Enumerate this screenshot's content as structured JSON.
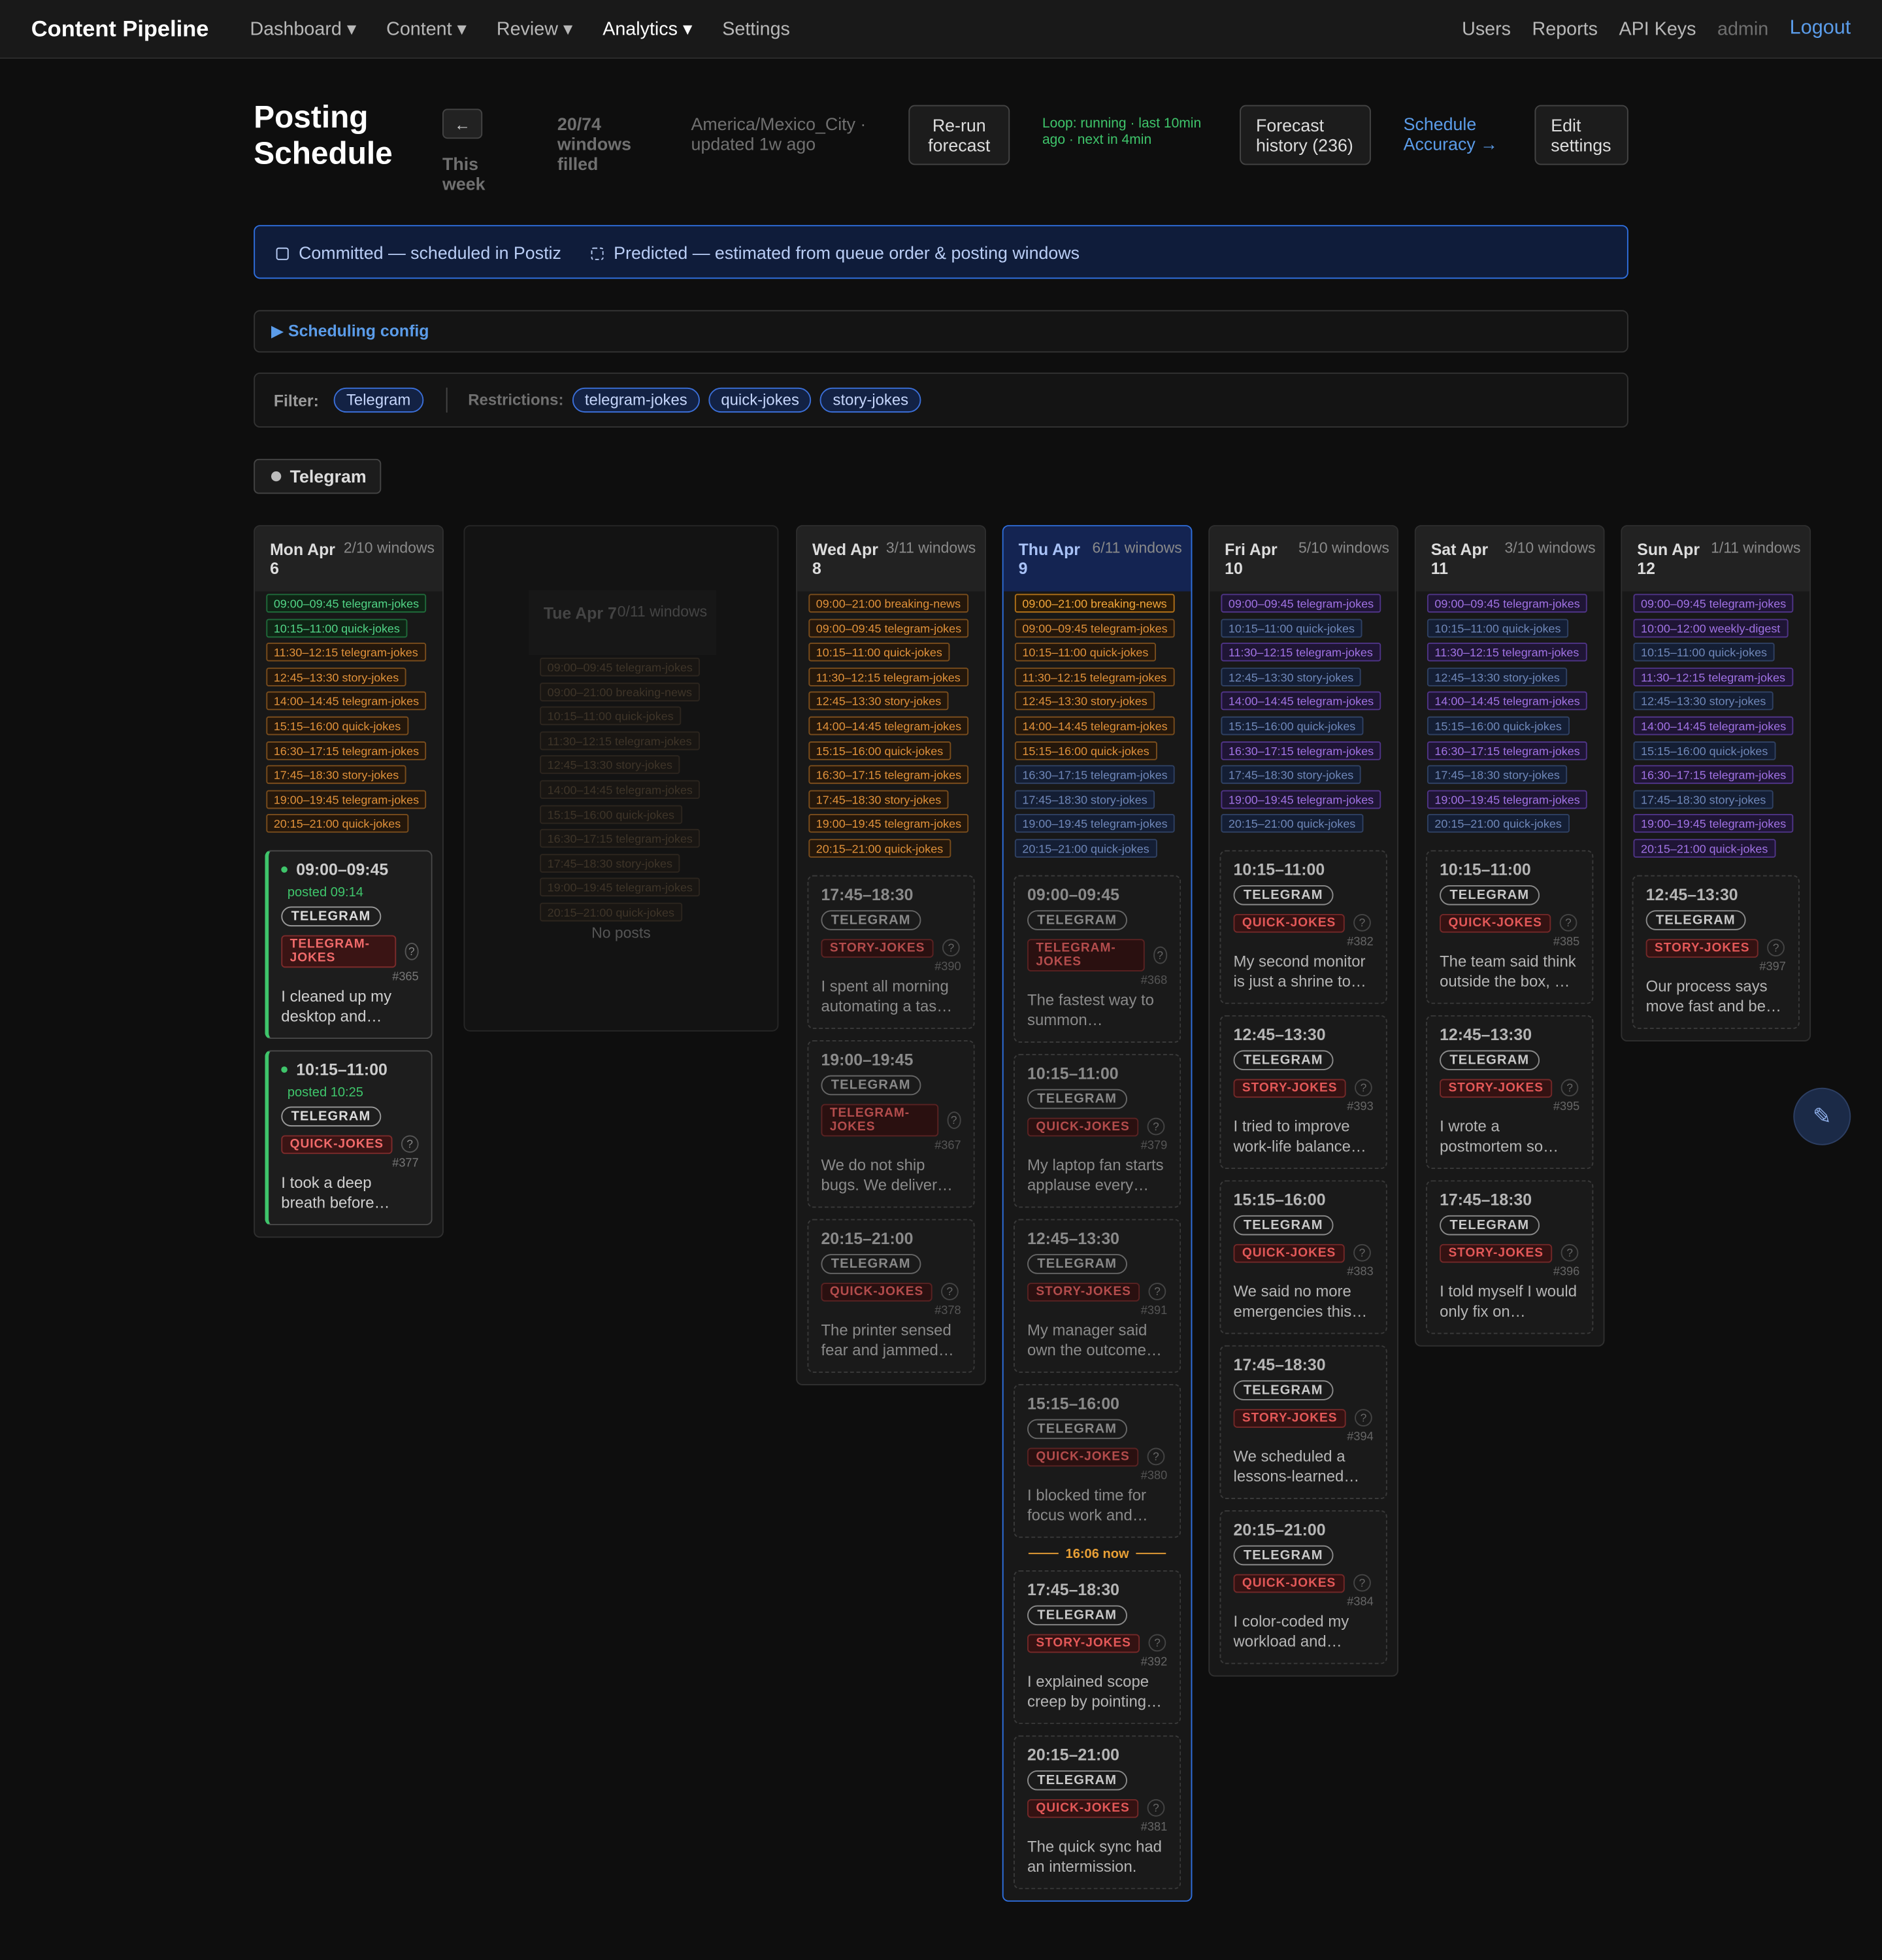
{
  "nav": {
    "brand": "Content Pipeline",
    "items": [
      "Dashboard ▾",
      "Content ▾",
      "Review ▾",
      "Analytics ▾",
      "Settings"
    ],
    "right": [
      "Users",
      "Reports",
      "API Keys"
    ],
    "user": "admin",
    "logout": "Logout"
  },
  "header": {
    "title": "Posting Schedule",
    "back": "←",
    "week": "This week",
    "filled": "20/74 windows filled",
    "timezone": "America/Mexico_City · updated 1w ago",
    "rerun": "Re-run forecast",
    "loop": "Loop: running · last 10min ago · next in 4min",
    "history": "Forecast history (236)",
    "accuracy": "Schedule Accuracy →",
    "edit": "Edit settings"
  },
  "legend": {
    "committed": "Committed — scheduled in Postiz",
    "predicted": "Predicted — estimated from queue order & posting windows"
  },
  "config": {
    "label": "▶  Scheduling config"
  },
  "filter": {
    "label": "Filter:",
    "channel": "Telegram",
    "restrictions_label": "Restrictions:",
    "restrictions": [
      "telegram-jokes",
      "quick-jokes",
      "story-jokes"
    ]
  },
  "channel_toggle": "Telegram",
  "days": [
    {
      "name": "Mon Apr 6",
      "count": "2/10 windows",
      "slots": [
        [
          "09:00–09:45 telegram-jokes",
          "g"
        ],
        [
          "10:15–11:00 quick-jokes",
          "g"
        ],
        [
          "11:30–12:15 telegram-jokes",
          "o"
        ],
        [
          "12:45–13:30 story-jokes",
          "o"
        ],
        [
          "14:00–14:45 telegram-jokes",
          "o"
        ],
        [
          "15:15–16:00 quick-jokes",
          "o"
        ],
        [
          "16:30–17:15 telegram-jokes",
          "o"
        ],
        [
          "17:45–18:30 story-jokes",
          "o"
        ],
        [
          "19:00–19:45 telegram-jokes",
          "o"
        ],
        [
          "20:15–21:00 quick-jokes",
          "o"
        ]
      ],
      "cards": [
        {
          "kind": "pub",
          "time": "09:00–09:45",
          "posted": "posted 09:14",
          "channel": "TELEGRAM",
          "tag": "TELEGRAM-JOKES",
          "id": "#365",
          "text": "I cleaned up my desktop and…"
        },
        {
          "kind": "pub",
          "time": "10:15–11:00",
          "posted": "posted 10:25",
          "channel": "TELEGRAM",
          "tag": "QUICK-JOKES",
          "id": "#377",
          "text": "I took a deep breath before…"
        }
      ]
    },
    {
      "name": "Tue Apr 7",
      "count": "0/11 windows",
      "slots": [
        [
          "09:00–09:45 telegram-jokes",
          "d"
        ],
        [
          "09:00–21:00 breaking-news",
          "d"
        ],
        [
          "10:15–11:00 quick-jokes",
          "d"
        ],
        [
          "11:30–12:15 telegram-jokes",
          "d"
        ],
        [
          "12:45–13:30 story-jokes",
          "d"
        ],
        [
          "14:00–14:45 telegram-jokes",
          "d"
        ],
        [
          "15:15–16:00 quick-jokes",
          "d"
        ],
        [
          "16:30–17:15 telegram-jokes",
          "d"
        ],
        [
          "17:45–18:30 story-jokes",
          "d"
        ],
        [
          "19:00–19:45 telegram-jokes",
          "d"
        ],
        [
          "20:15–21:00 quick-jokes",
          "d"
        ]
      ],
      "empty": "No posts",
      "cards": []
    },
    {
      "name": "Wed Apr 8",
      "count": "3/11 windows",
      "slots": [
        [
          "09:00–21:00 breaking-news",
          "o"
        ],
        [
          "09:00–09:45 telegram-jokes",
          "o"
        ],
        [
          "10:15–11:00 quick-jokes",
          "o"
        ],
        [
          "11:30–12:15 telegram-jokes",
          "o"
        ],
        [
          "12:45–13:30 story-jokes",
          "o"
        ],
        [
          "14:00–14:45 telegram-jokes",
          "o"
        ],
        [
          "15:15–16:00 quick-jokes",
          "o"
        ],
        [
          "16:30–17:15 telegram-jokes",
          "o"
        ],
        [
          "17:45–18:30 story-jokes",
          "o"
        ],
        [
          "19:00–19:45 telegram-jokes",
          "o"
        ],
        [
          "20:15–21:00 quick-jokes",
          "o"
        ]
      ],
      "cards": [
        {
          "kind": "pred",
          "time": "17:45–18:30",
          "channel": "TELEGRAM",
          "tag": "STORY-JOKES",
          "id": "#390",
          "text": "I spent all morning automating a tas…"
        },
        {
          "kind": "pred",
          "time": "19:00–19:45",
          "channel": "TELEGRAM",
          "tag": "TELEGRAM-JOKES",
          "id": "#367",
          "text": "We do not ship bugs. We deliver…"
        },
        {
          "kind": "pred",
          "time": "20:15–21:00",
          "channel": "TELEGRAM",
          "tag": "QUICK-JOKES",
          "id": "#378",
          "text": "The printer sensed fear and jammed…"
        }
      ]
    },
    {
      "name": "Thu Apr 9",
      "count": "6/11 windows",
      "today": true,
      "slots": [
        [
          "09:00–21:00 breaking-news",
          "y"
        ],
        [
          "09:00–09:45 telegram-jokes",
          "o"
        ],
        [
          "10:15–11:00 quick-jokes",
          "o"
        ],
        [
          "11:30–12:15 telegram-jokes",
          "o"
        ],
        [
          "12:45–13:30 story-jokes",
          "o"
        ],
        [
          "14:00–14:45 telegram-jokes",
          "o"
        ],
        [
          "15:15–16:00 quick-jokes",
          "o"
        ],
        [
          "16:30–17:15 telegram-jokes",
          "b"
        ],
        [
          "17:45–18:30 story-jokes",
          "b"
        ],
        [
          "19:00–19:45 telegram-jokes",
          "b"
        ],
        [
          "20:15–21:00 quick-jokes",
          "b"
        ]
      ],
      "cards": [
        {
          "kind": "pred",
          "time": "09:00–09:45",
          "channel": "TELEGRAM",
          "tag": "TELEGRAM-JOKES",
          "id": "#368",
          "text": "The fastest way to summon…"
        },
        {
          "kind": "pred",
          "time": "10:15–11:00",
          "channel": "TELEGRAM",
          "tag": "QUICK-JOKES",
          "id": "#379",
          "text": "My laptop fan starts applause every…"
        },
        {
          "kind": "pred",
          "time": "12:45–13:30",
          "channel": "TELEGRAM",
          "tag": "STORY-JOKES",
          "id": "#391",
          "text": "My manager said own the outcome…"
        },
        {
          "kind": "pred",
          "time": "15:15–16:00",
          "channel": "TELEGRAM",
          "tag": "QUICK-JOKES",
          "id": "#380",
          "text": "I blocked time for focus work and…"
        },
        {
          "kind": "now",
          "label": "16:06 now"
        },
        {
          "kind": "fut",
          "time": "17:45–18:30",
          "channel": "TELEGRAM",
          "tag": "STORY-JOKES",
          "id": "#392",
          "text": "I explained scope creep by pointing…"
        },
        {
          "kind": "fut",
          "time": "20:15–21:00",
          "channel": "TELEGRAM",
          "tag": "QUICK-JOKES",
          "id": "#381",
          "text": "The quick sync had an intermission."
        }
      ]
    },
    {
      "name": "Fri Apr 10",
      "count": "5/10 windows",
      "slots": [
        [
          "09:00–09:45 telegram-jokes",
          "p"
        ],
        [
          "10:15–11:00 quick-jokes",
          "b"
        ],
        [
          "11:30–12:15 telegram-jokes",
          "p"
        ],
        [
          "12:45–13:30 story-jokes",
          "b"
        ],
        [
          "14:00–14:45 telegram-jokes",
          "p"
        ],
        [
          "15:15–16:00 quick-jokes",
          "b"
        ],
        [
          "16:30–17:15 telegram-jokes",
          "p"
        ],
        [
          "17:45–18:30 story-jokes",
          "b"
        ],
        [
          "19:00–19:45 telegram-jokes",
          "p"
        ],
        [
          "20:15–21:00 quick-jokes",
          "b"
        ]
      ],
      "cards": [
        {
          "kind": "fut",
          "time": "10:15–11:00",
          "channel": "TELEGRAM",
          "tag": "QUICK-JOKES",
          "id": "#382",
          "text": "My second monitor is just a shrine to…"
        },
        {
          "kind": "fut",
          "time": "12:45–13:30",
          "channel": "TELEGRAM",
          "tag": "STORY-JOKES",
          "id": "#393",
          "text": "I tried to improve work-life balance…"
        },
        {
          "kind": "fut",
          "time": "15:15–16:00",
          "channel": "TELEGRAM",
          "tag": "QUICK-JOKES",
          "id": "#383",
          "text": "We said no more emergencies this…"
        },
        {
          "kind": "fut",
          "time": "17:45–18:30",
          "channel": "TELEGRAM",
          "tag": "STORY-JOKES",
          "id": "#394",
          "text": "We scheduled a lessons-learned…"
        },
        {
          "kind": "fut",
          "time": "20:15–21:00",
          "channel": "TELEGRAM",
          "tag": "QUICK-JOKES",
          "id": "#384",
          "text": "I color-coded my workload and…"
        }
      ]
    },
    {
      "name": "Sat Apr 11",
      "count": "3/10 windows",
      "slots": [
        [
          "09:00–09:45 telegram-jokes",
          "p"
        ],
        [
          "10:15–11:00 quick-jokes",
          "b"
        ],
        [
          "11:30–12:15 telegram-jokes",
          "p"
        ],
        [
          "12:45–13:30 story-jokes",
          "b"
        ],
        [
          "14:00–14:45 telegram-jokes",
          "p"
        ],
        [
          "15:15–16:00 quick-jokes",
          "b"
        ],
        [
          "16:30–17:15 telegram-jokes",
          "p"
        ],
        [
          "17:45–18:30 story-jokes",
          "b"
        ],
        [
          "19:00–19:45 telegram-jokes",
          "p"
        ],
        [
          "20:15–21:00 quick-jokes",
          "b"
        ]
      ],
      "cards": [
        {
          "kind": "fut",
          "time": "10:15–11:00",
          "channel": "TELEGRAM",
          "tag": "QUICK-JOKES",
          "id": "#385",
          "text": "The team said think outside the box, …"
        },
        {
          "kind": "fut",
          "time": "12:45–13:30",
          "channel": "TELEGRAM",
          "tag": "STORY-JOKES",
          "id": "#395",
          "text": "I wrote a postmortem so…"
        },
        {
          "kind": "fut",
          "time": "17:45–18:30",
          "channel": "TELEGRAM",
          "tag": "STORY-JOKES",
          "id": "#396",
          "text": "I told myself I would only fix on…"
        }
      ]
    },
    {
      "name": "Sun Apr 12",
      "count": "1/11 windows",
      "slots": [
        [
          "09:00–09:45 telegram-jokes",
          "p"
        ],
        [
          "10:00–12:00 weekly-digest",
          "p"
        ],
        [
          "10:15–11:00 quick-jokes",
          "b"
        ],
        [
          "11:30–12:15 telegram-jokes",
          "p"
        ],
        [
          "12:45–13:30 story-jokes",
          "b"
        ],
        [
          "14:00–14:45 telegram-jokes",
          "p"
        ],
        [
          "15:15–16:00 quick-jokes",
          "b"
        ],
        [
          "16:30–17:15 telegram-jokes",
          "p"
        ],
        [
          "17:45–18:30 story-jokes",
          "b"
        ],
        [
          "19:00–19:45 telegram-jokes",
          "p"
        ],
        [
          "20:15–21:00 quick-jokes",
          "p"
        ]
      ],
      "cards": [
        {
          "kind": "fut",
          "time": "12:45–13:30",
          "channel": "TELEGRAM",
          "tag": "STORY-JOKES",
          "id": "#397",
          "text": "Our process says move fast and be…"
        }
      ]
    }
  ],
  "fab": "✎"
}
